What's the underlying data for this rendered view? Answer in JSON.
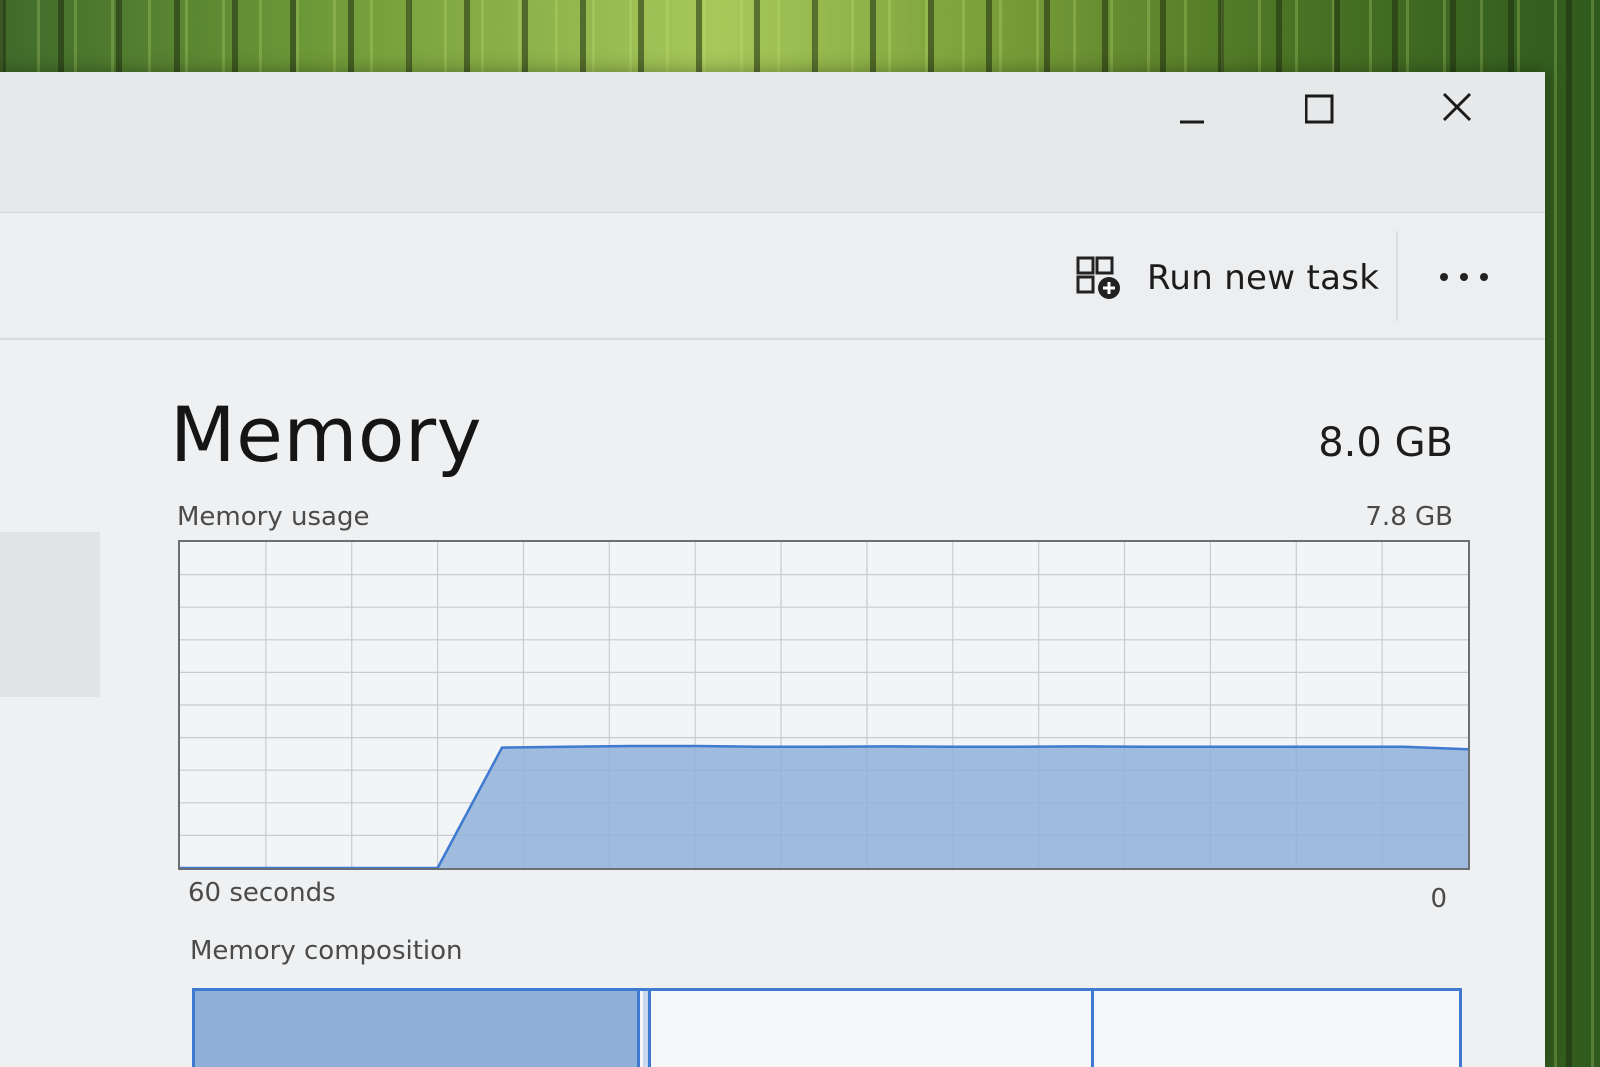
{
  "window": {
    "controls": {
      "minimize_icon": "minimize-icon",
      "maximize_icon": "maximize-icon",
      "close_icon": "close-icon"
    }
  },
  "commandbar": {
    "run_new_task": {
      "label": "Run new task",
      "icon": "run-task-icon"
    },
    "more_icon": "more-options-icon"
  },
  "memory": {
    "title": "Memory",
    "total": "8.0 GB",
    "usage_label": "Memory usage",
    "usage_max": "7.8 GB",
    "time_start": "60 seconds",
    "time_end": "0",
    "composition_label": "Memory composition"
  },
  "colors": {
    "accent": "#3f7ad1",
    "fill": "#8fb0d8",
    "grid": "#c8cbd0"
  },
  "chart_data": {
    "type": "area",
    "xlabel_left": "60 seconds",
    "xlabel_right": "0",
    "ylim": [
      0,
      7.8
    ],
    "unit": "GB",
    "x": [
      60,
      57,
      54,
      51,
      48,
      45,
      42,
      39,
      36,
      33,
      30,
      27,
      24,
      21,
      18,
      15,
      12,
      9,
      6,
      3,
      0
    ],
    "values": [
      0,
      0,
      0,
      0,
      0,
      2.88,
      2.9,
      2.92,
      2.92,
      2.9,
      2.9,
      2.91,
      2.9,
      2.9,
      2.91,
      2.9,
      2.9,
      2.9,
      2.9,
      2.9,
      2.84
    ],
    "grid": true
  }
}
